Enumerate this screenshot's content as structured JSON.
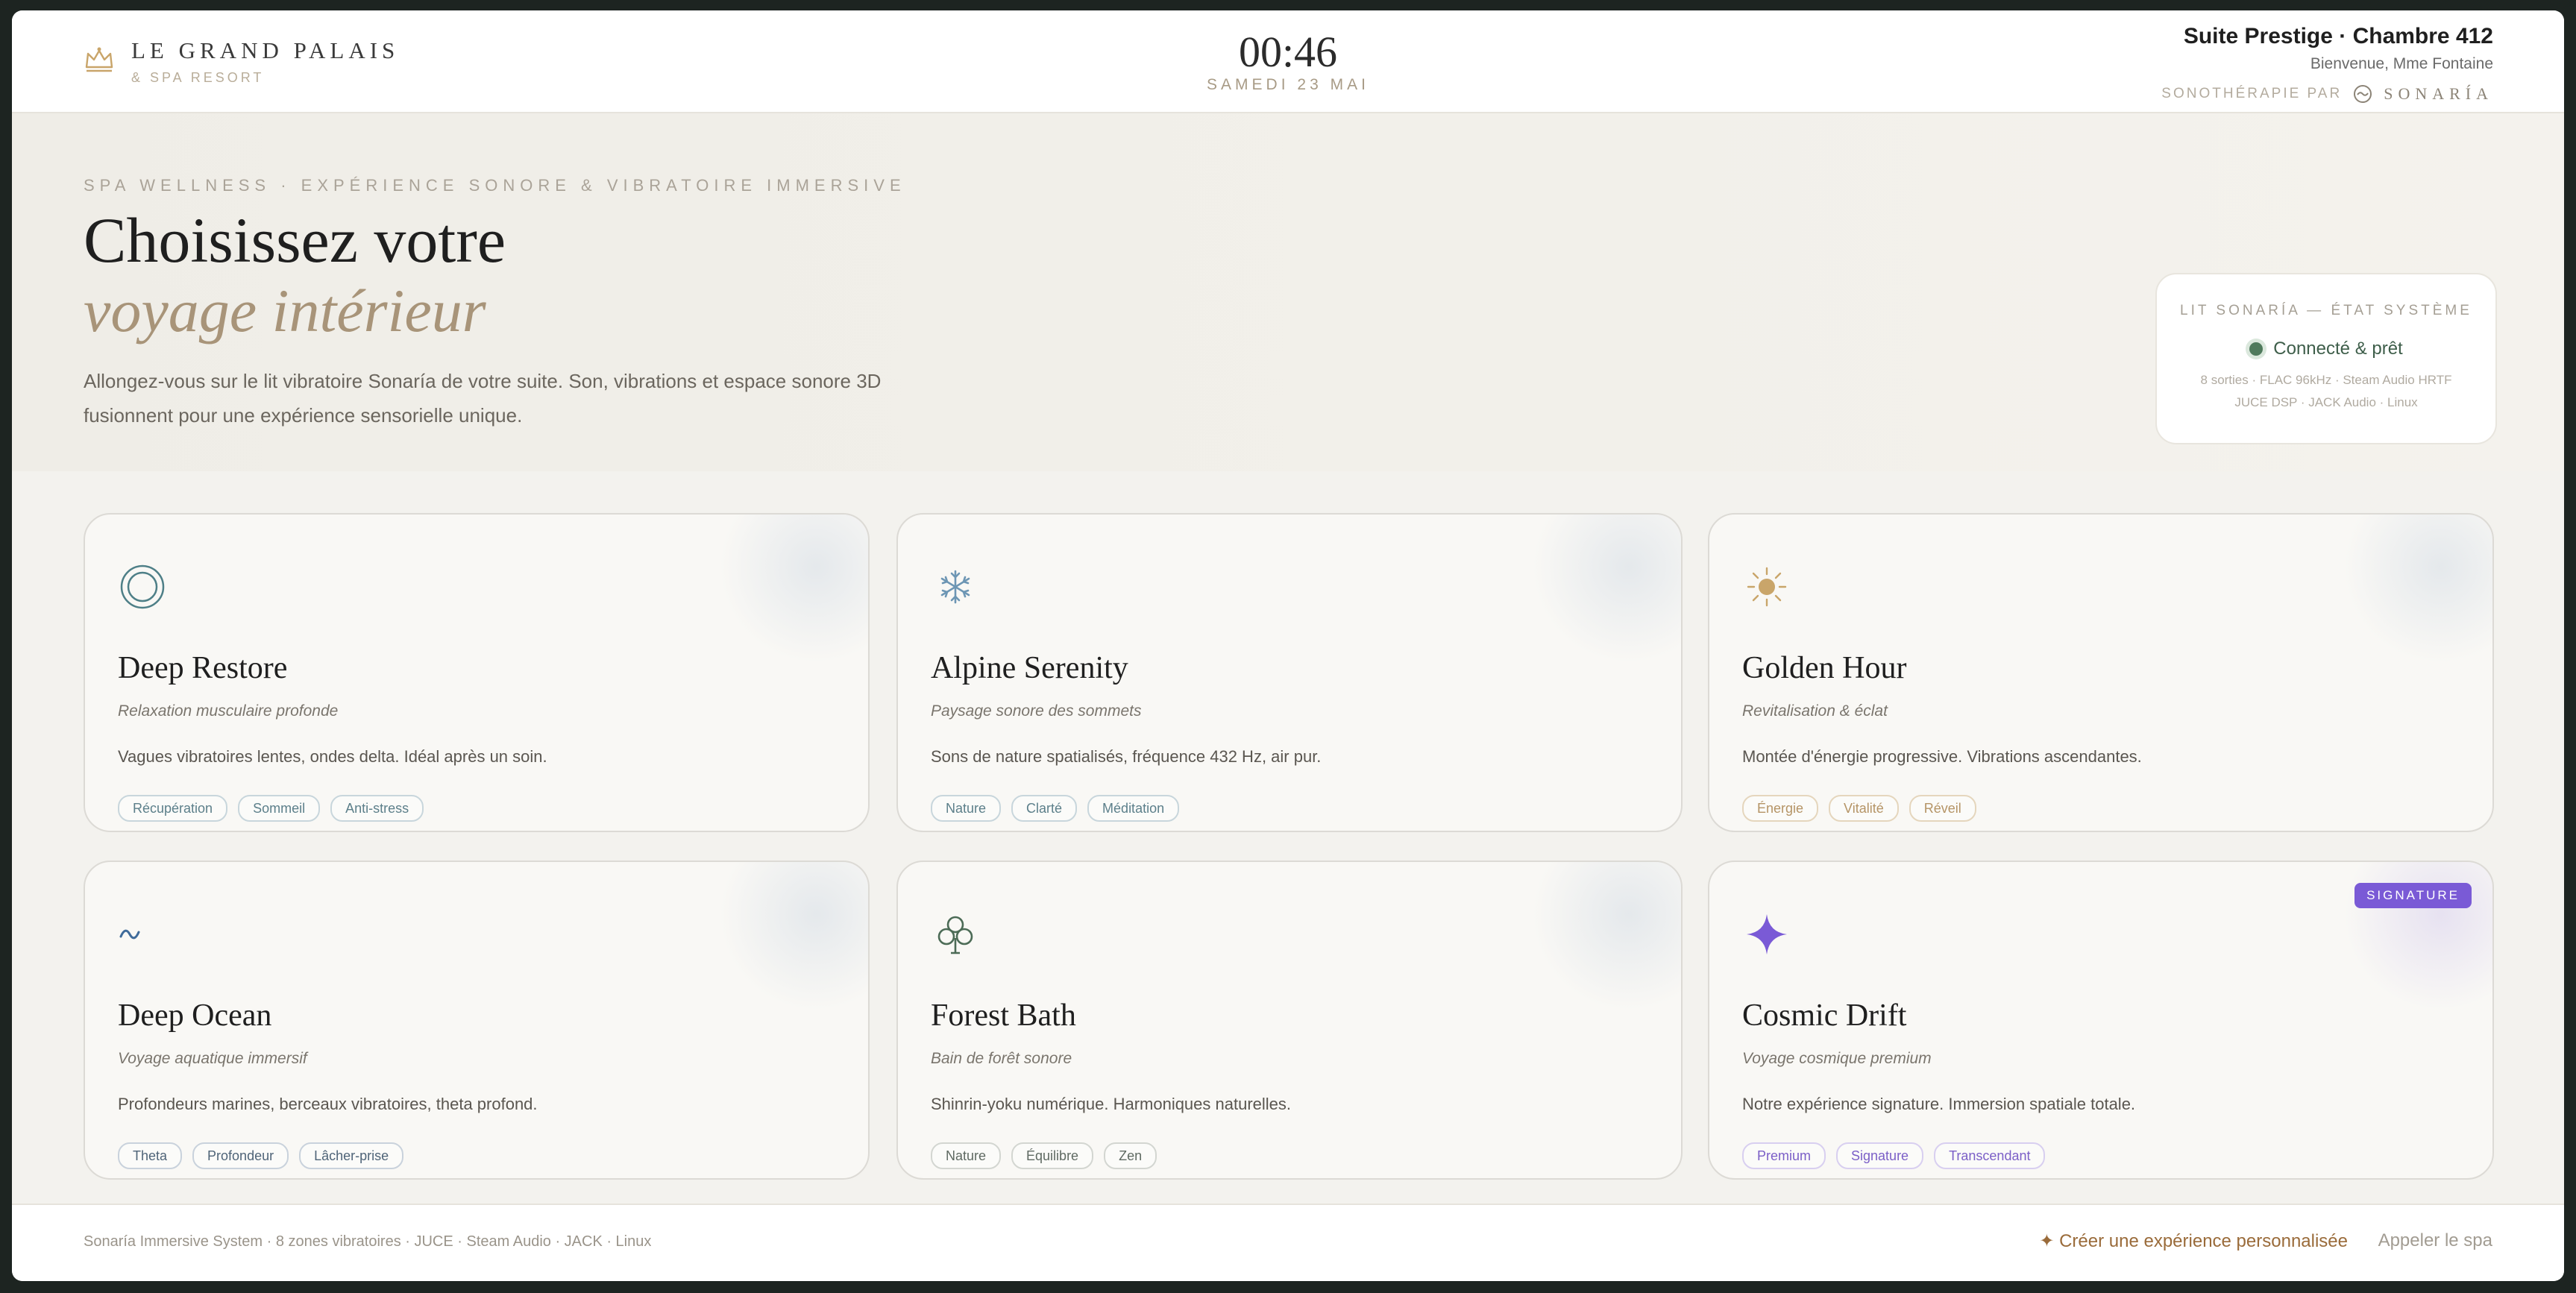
{
  "header": {
    "brand_name": "LE GRAND PALAIS",
    "brand_sub": "& SPA RESORT",
    "clock": "00:46",
    "date": "SAMEDI 23 MAI",
    "suite": "Suite Prestige · Chambre 412",
    "welcome": "Bienvenue, Mme Fontaine",
    "sono_prefix": "SONOTHÉRAPIE PAR",
    "sono_brand": "SONARÍA"
  },
  "hero": {
    "eyebrow": "SPA WELLNESS · EXPÉRIENCE SONORE & VIBRATOIRE IMMERSIVE",
    "title_line1": "Choisissez votre",
    "title_line2": "voyage intérieur",
    "intro": "Allongez-vous sur le lit vibratoire Sonaría de votre suite. Son, vibrations et espace sonore 3D fusionnent pour une expérience sensorielle unique."
  },
  "status": {
    "heading": "LIT SONARÍA — ÉTAT SYSTÈME",
    "state": "Connecté & prêt",
    "meta_line1": "8 sorties · FLAC 96kHz · Steam Audio HRTF",
    "meta_line2": "JUCE DSP · JACK Audio · Linux"
  },
  "cards": [
    {
      "title": "Deep Restore",
      "subtitle": "Relaxation musculaire profonde",
      "description": "Vagues vibratoires lentes, ondes delta. Idéal après un soin.",
      "icon": "concentric-circles-icon",
      "tags": [
        "Récupération",
        "Sommeil",
        "Anti-stress"
      ]
    },
    {
      "title": "Alpine Serenity",
      "subtitle": "Paysage sonore des sommets",
      "description": "Sons de nature spatialisés, fréquence 432 Hz, air pur.",
      "icon": "snowflake-icon",
      "tags": [
        "Nature",
        "Clarté",
        "Méditation"
      ]
    },
    {
      "title": "Golden Hour",
      "subtitle": "Revitalisation & éclat",
      "description": "Montée d'énergie progressive. Vibrations ascendantes.",
      "icon": "sun-icon",
      "tags": [
        "Énergie",
        "Vitalité",
        "Réveil"
      ]
    },
    {
      "title": "Deep Ocean",
      "subtitle": "Voyage aquatique immersif",
      "description": "Profondeurs marines, berceaux vibratoires, theta profond.",
      "icon": "wave-icon",
      "tags": [
        "Theta",
        "Profondeur",
        "Lâcher-prise"
      ]
    },
    {
      "title": "Forest Bath",
      "subtitle": "Bain de forêt sonore",
      "description": "Shinrin-yoku numérique. Harmoniques naturelles.",
      "icon": "clover-icon",
      "tags": [
        "Nature",
        "Équilibre",
        "Zen"
      ]
    },
    {
      "title": "Cosmic Drift",
      "subtitle": "Voyage cosmique premium",
      "description": "Notre expérience signature. Immersion spatiale totale.",
      "icon": "star-sparkle-icon",
      "badge": "SIGNATURE",
      "tags": [
        "Premium",
        "Signature",
        "Transcendant"
      ]
    }
  ],
  "footer": {
    "left": "Sonaría Immersive System · 8 zones vibratoires · JUCE · Steam Audio · JACK · Linux",
    "cta": "✦ Créer une expérience personnalisée",
    "call": "Appeler le spa"
  },
  "colors": {
    "accent_gold": "#a89479",
    "status_green": "#4f7a5c",
    "signature_violet": "#7a5ad6"
  }
}
